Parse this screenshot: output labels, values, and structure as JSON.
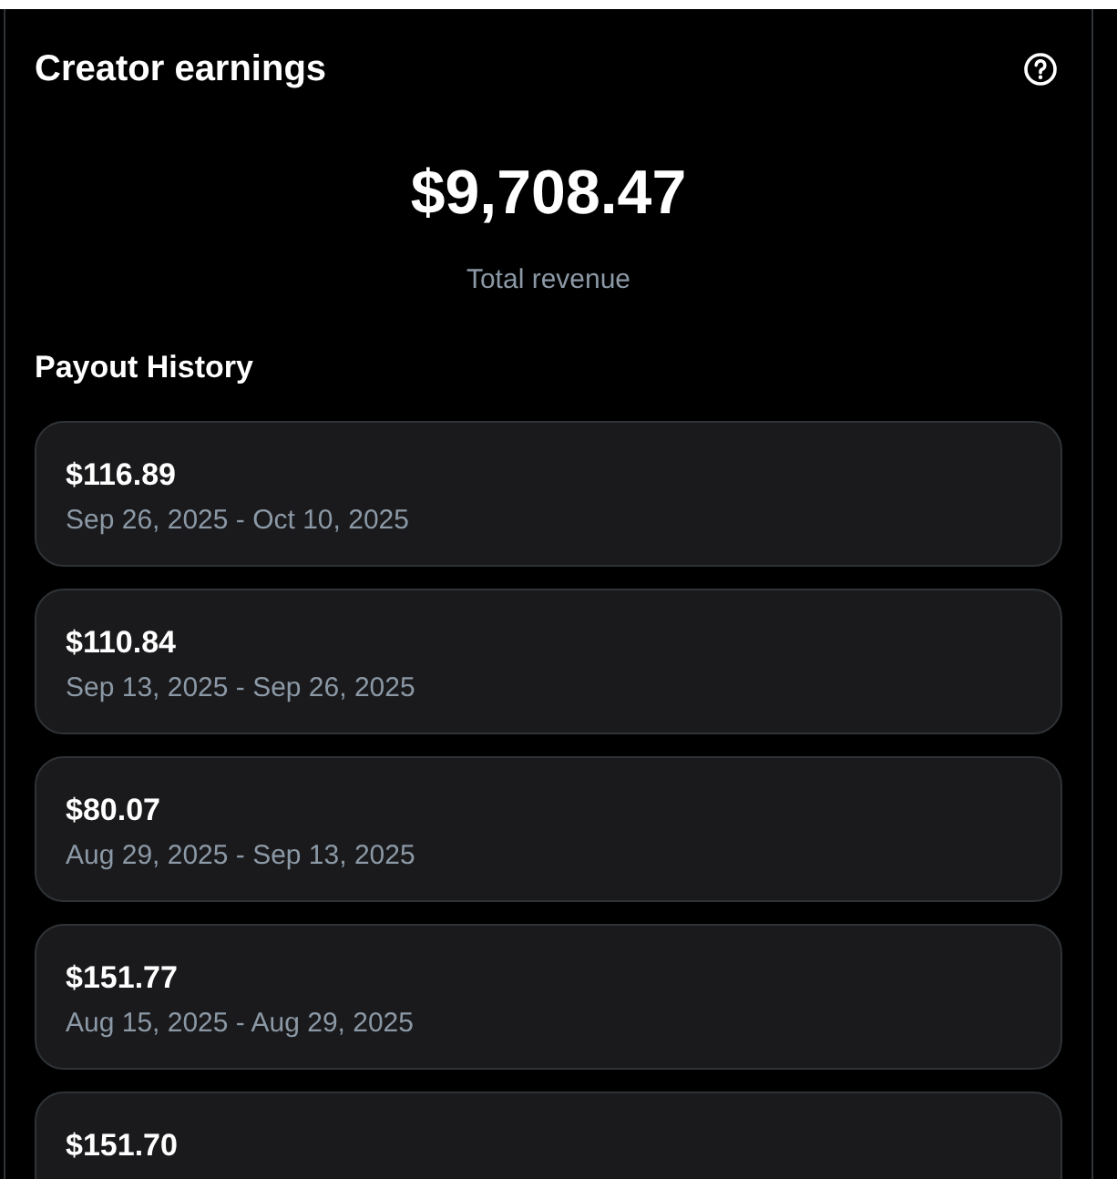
{
  "header": {
    "title": "Creator earnings"
  },
  "total": {
    "amount": "$9,708.47",
    "label": "Total revenue"
  },
  "payout_history": {
    "title": "Payout History",
    "payouts": [
      {
        "amount": "$116.89",
        "period": "Sep 26, 2025 - Oct 10, 2025"
      },
      {
        "amount": "$110.84",
        "period": "Sep 13, 2025 - Sep 26, 2025"
      },
      {
        "amount": "$80.07",
        "period": "Aug 29, 2025 - Sep 13, 2025"
      },
      {
        "amount": "$151.77",
        "period": "Aug 15, 2025 - Aug 29, 2025"
      },
      {
        "amount": "$151.70"
      }
    ]
  }
}
